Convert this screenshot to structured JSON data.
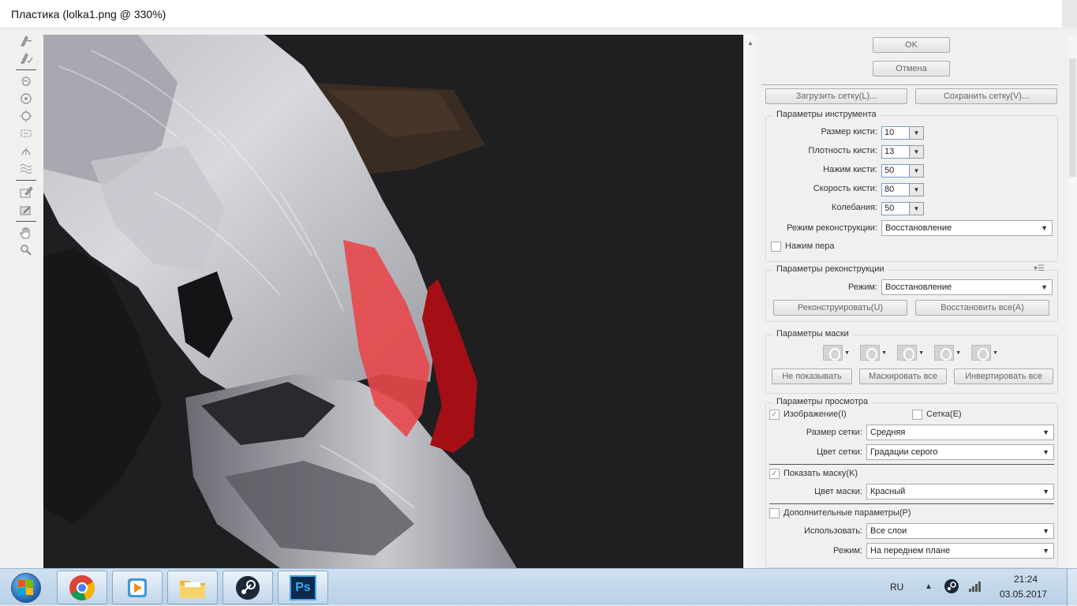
{
  "window": {
    "title": "Пластика (lolka1.png @ 330%)"
  },
  "tools": [
    "warp-tool",
    "reconstruct-tool",
    "twirl-tool",
    "pucker-tool",
    "bloat-tool",
    "push-left-tool",
    "mirror-tool",
    "turbulence-tool",
    "freeze-mask-tool",
    "thaw-mask-tool",
    "hand-tool",
    "zoom-tool"
  ],
  "dialog": {
    "ok": "OK",
    "cancel": "Отмена",
    "load_mesh": "Загрузить сетку(L)...",
    "save_mesh": "Сохранить сетку(V)..."
  },
  "tool_options": {
    "title": "Параметры инструмента",
    "brush_size_label": "Размер кисти:",
    "brush_size": "10",
    "brush_density_label": "Плотность кисти:",
    "brush_density": "13",
    "brush_pressure_label": "Нажим кисти:",
    "brush_pressure": "50",
    "brush_rate_label": "Скорость кисти:",
    "brush_rate": "80",
    "turbulent_jitter_label": "Колебания:",
    "turbulent_jitter": "50",
    "reconstruct_mode_label": "Режим реконструкции:",
    "reconstruct_mode": "Восстановление",
    "stylus_pressure_label": "Нажим пера"
  },
  "reconstruct_options": {
    "title": "Параметры реконструкции",
    "mode_label": "Режим:",
    "mode": "Восстановление",
    "reconstruct_btn": "Реконструировать(U)",
    "restore_all_btn": "Восстановить все(A)"
  },
  "mask_options": {
    "title": "Параметры маски",
    "none_btn": "Не показывать",
    "mask_all_btn": "Маскировать все",
    "invert_all_btn": "Инвертировать все"
  },
  "view_options": {
    "title": "Параметры просмотра",
    "show_image_label": "Изображение(I)",
    "show_image_checked": true,
    "show_mesh_label": "Сетка(E)",
    "show_mesh_checked": false,
    "mesh_size_label": "Размер сетки:",
    "mesh_size": "Средняя",
    "mesh_color_label": "Цвет сетки:",
    "mesh_color": "Градации серого",
    "show_mask_label": "Показать маску(K)",
    "show_mask_checked": true,
    "mask_color_label": "Цвет маски:",
    "mask_color": "Красный",
    "show_backdrop_label": "Дополнительные параметры(P)",
    "show_backdrop_checked": false,
    "use_label": "Использовать:",
    "use": "Все слои",
    "mode_label": "Режим:",
    "mode": "На переднем плане"
  },
  "taskbar": {
    "apps": [
      "chrome-icon",
      "media-player-icon",
      "explorer-icon",
      "steam-icon",
      "photoshop-icon"
    ],
    "photoshop_label": "Ps",
    "language": "RU",
    "time": "21:24",
    "date": "03.05.2017"
  },
  "colors": {
    "canvas_bg": "#1f1f22",
    "mask_red": "#e8474a",
    "mask_dark_red": "#a30f14",
    "photoshop_blue": "#0b2a4a",
    "taskbar_bg": "#c6dbef"
  }
}
